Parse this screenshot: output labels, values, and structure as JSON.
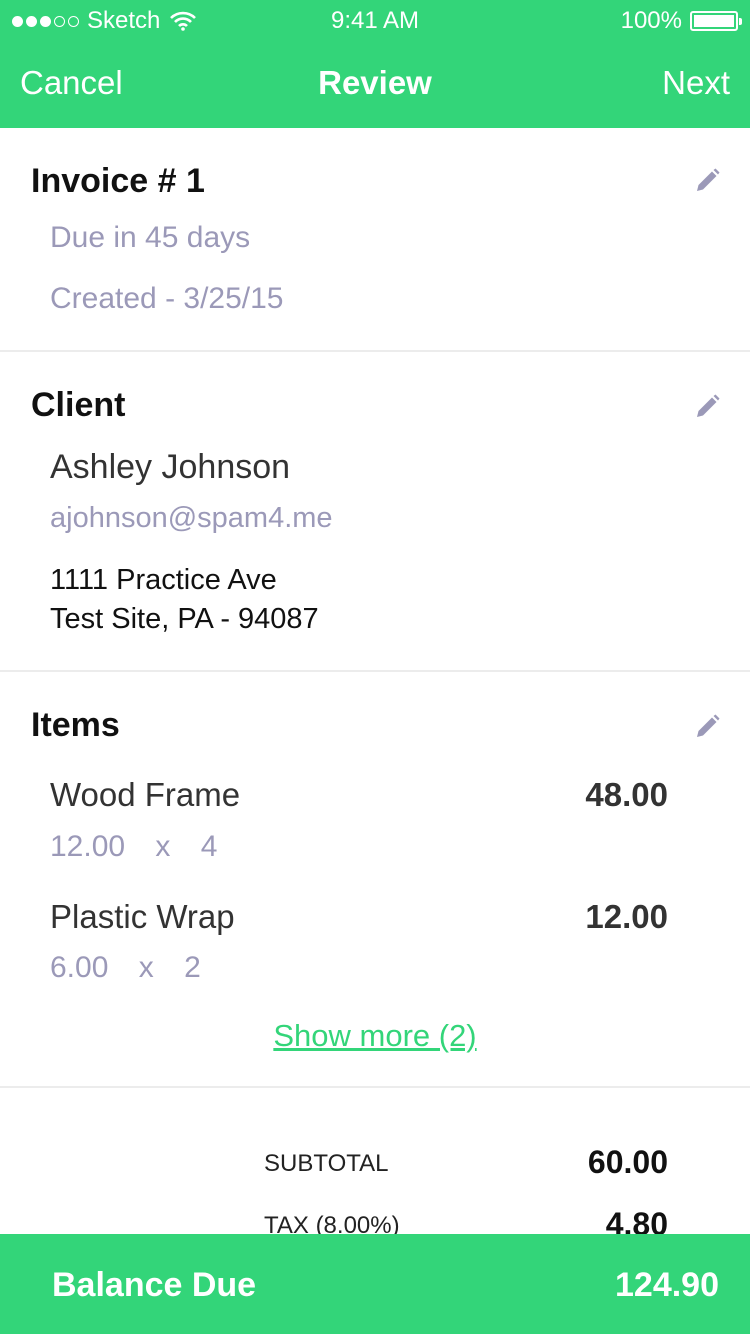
{
  "status_bar": {
    "carrier": "Sketch",
    "time": "9:41 AM",
    "battery": "100%"
  },
  "nav": {
    "cancel_label": "Cancel",
    "title": "Review",
    "next_label": "Next"
  },
  "invoice": {
    "title": "Invoice # 1",
    "due": "Due in 45 days",
    "created": "Created - 3/25/15"
  },
  "client": {
    "title": "Client",
    "name": "Ashley Johnson",
    "email": "ajohnson@spam4.me",
    "address_line1": "1111 Practice Ave",
    "address_line2": "Test Site, PA - 94087"
  },
  "items": {
    "title": "Items",
    "list": [
      {
        "name": "Wood Frame",
        "unit_price": "12.00",
        "times": "x",
        "qty": "4",
        "amount": "48.00"
      },
      {
        "name": "Plastic Wrap",
        "unit_price": "6.00",
        "times": "x",
        "qty": "2",
        "amount": "12.00"
      }
    ],
    "show_more": "Show more (2)"
  },
  "totals": {
    "subtotal_label": "SUBTOTAL",
    "subtotal_value": "60.00",
    "tax_label": "TAX (8.00%)",
    "tax_value": "4.80"
  },
  "footer": {
    "label": "Balance Due",
    "value": "124.90"
  },
  "colors": {
    "accent": "#33d579",
    "muted_text": "#9b99b8",
    "divider": "#ececec"
  }
}
